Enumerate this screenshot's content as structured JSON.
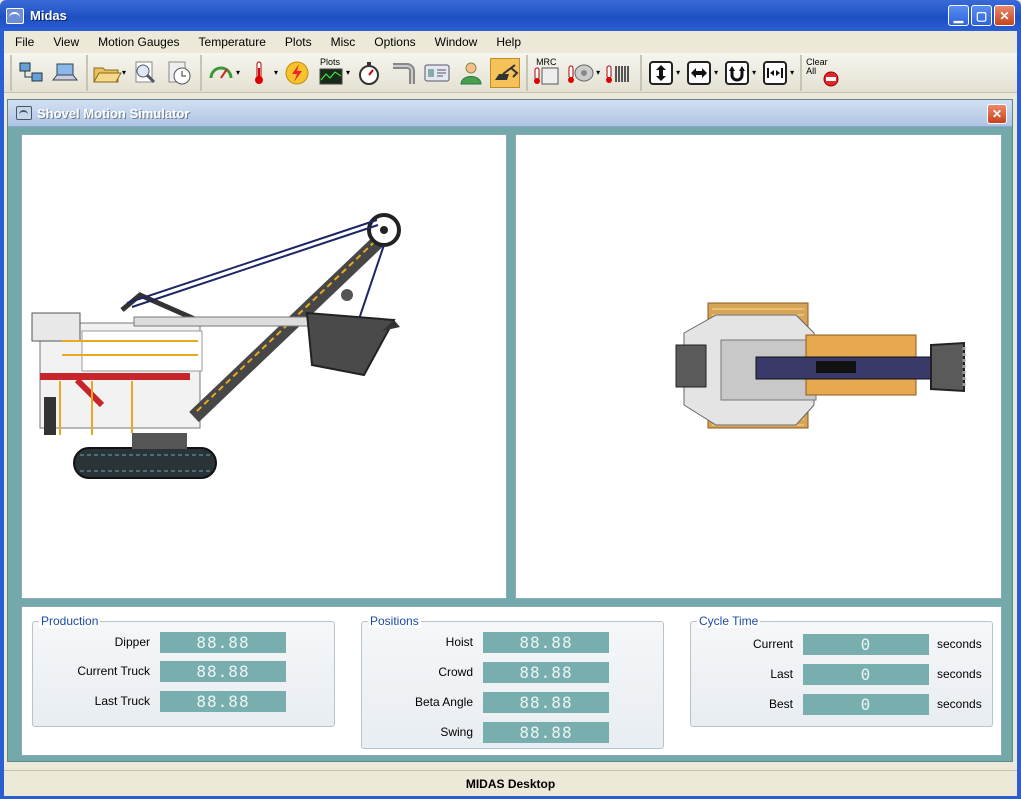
{
  "app": {
    "title": "Midas"
  },
  "menu": [
    "File",
    "View",
    "Motion Gauges",
    "Temperature",
    "Plots",
    "Misc",
    "Options",
    "Window",
    "Help"
  ],
  "toolbar": {
    "plots_label": "Plots",
    "mrc_label": "MRC",
    "clear_all_label_1": "Clear",
    "clear_all_label_2": "All",
    "icons": [
      "network-icon",
      "laptop-icon",
      "open-folder-icon",
      "search-doc-icon",
      "clock-doc-icon",
      "gauge-icon",
      "thermometer-icon",
      "lightning-icon",
      "plots-icon",
      "stopwatch-icon",
      "pipe-icon",
      "id-card-icon",
      "operator-icon",
      "shovel-icon",
      "mrc-thermo-icon",
      "motor-thermo-icon",
      "coil-thermo-icon",
      "hoist-arrow-icon",
      "crowd-arrow-icon",
      "swing-arrow-icon",
      "stop-arrow-icon",
      "clear-all-icon"
    ]
  },
  "child_window": {
    "title": "Shovel Motion Simulator"
  },
  "production": {
    "title": "Production",
    "rows": [
      {
        "label": "Dipper",
        "value": "88.88"
      },
      {
        "label": "Current Truck",
        "value": "88.88"
      },
      {
        "label": "Last Truck",
        "value": "88.88"
      }
    ]
  },
  "positions": {
    "title": "Positions",
    "rows": [
      {
        "label": "Hoist",
        "value": "88.88"
      },
      {
        "label": "Crowd",
        "value": "88.88"
      },
      {
        "label": "Beta Angle",
        "value": "88.88"
      },
      {
        "label": "Swing",
        "value": "88.88"
      }
    ]
  },
  "cycle_time": {
    "title": "Cycle Time",
    "unit": "seconds",
    "rows": [
      {
        "label": "Current",
        "value": "0"
      },
      {
        "label": "Last",
        "value": "0"
      },
      {
        "label": "Best",
        "value": "0"
      }
    ]
  },
  "status": {
    "text": "MIDAS Desktop"
  },
  "colors": {
    "lcd": "#79aeae",
    "child_bg": "#74a9ab",
    "titlebar": "#2456c8"
  }
}
